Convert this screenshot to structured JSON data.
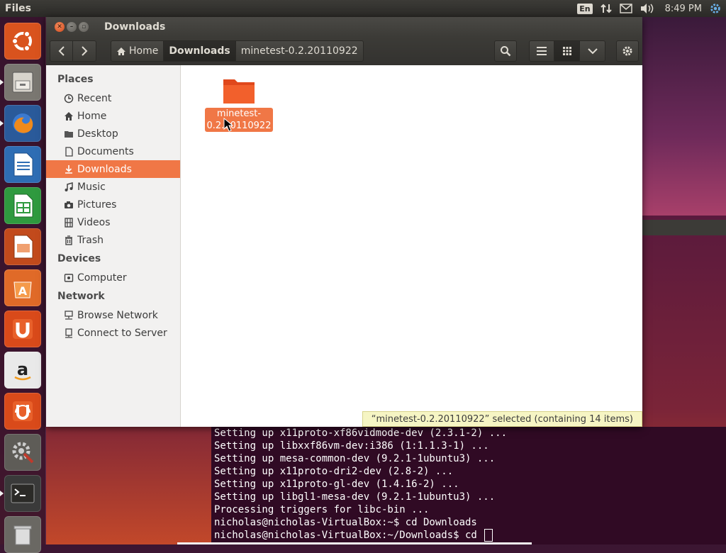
{
  "top_panel": {
    "app_title": "Files",
    "keyboard_layout": "En",
    "clock": "8:49 PM",
    "indicators": [
      "network-icon",
      "mail-icon",
      "volume-icon",
      "settings-gear-icon"
    ]
  },
  "launcher": {
    "items": [
      {
        "name": "dash-home",
        "icon": "ubuntu-logo-icon"
      },
      {
        "name": "files",
        "icon": "file-cabinet-icon",
        "running": true
      },
      {
        "name": "firefox",
        "icon": "firefox-icon",
        "running": true
      },
      {
        "name": "libreoffice-writer",
        "icon": "writer-icon"
      },
      {
        "name": "libreoffice-calc",
        "icon": "calc-icon"
      },
      {
        "name": "libreoffice-impress",
        "icon": "impress-icon"
      },
      {
        "name": "ubuntu-software-center",
        "icon": "software-center-icon"
      },
      {
        "name": "ubuntu-one",
        "icon": "ubuntu-one-icon"
      },
      {
        "name": "amazon",
        "icon": "amazon-icon"
      },
      {
        "name": "ubuntu-one-music",
        "icon": "ubuntu-one-music-icon"
      },
      {
        "name": "system-settings",
        "icon": "system-settings-icon"
      },
      {
        "name": "terminal",
        "icon": "terminal-icon",
        "running": true
      },
      {
        "name": "trash",
        "icon": "trash-icon"
      }
    ]
  },
  "window": {
    "title": "Downloads",
    "breadcrumbs": [
      "Home",
      "Downloads",
      "minetest-0.2.20110922"
    ],
    "active_crumb": "Downloads"
  },
  "sidebar": {
    "sections": [
      {
        "title": "Places",
        "items": [
          {
            "label": "Recent",
            "icon": "clock-icon"
          },
          {
            "label": "Home",
            "icon": "home-icon"
          },
          {
            "label": "Desktop",
            "icon": "desktop-folder-icon"
          },
          {
            "label": "Documents",
            "icon": "document-icon"
          },
          {
            "label": "Downloads",
            "icon": "download-arrow-icon",
            "selected": true
          },
          {
            "label": "Music",
            "icon": "music-note-icon"
          },
          {
            "label": "Pictures",
            "icon": "camera-icon"
          },
          {
            "label": "Videos",
            "icon": "film-icon"
          },
          {
            "label": "Trash",
            "icon": "trash-icon"
          }
        ]
      },
      {
        "title": "Devices",
        "items": [
          {
            "label": "Computer",
            "icon": "harddisk-icon"
          }
        ]
      },
      {
        "title": "Network",
        "items": [
          {
            "label": "Browse Network",
            "icon": "network-icon"
          },
          {
            "label": "Connect to Server",
            "icon": "server-icon"
          }
        ]
      }
    ]
  },
  "files": [
    {
      "name": "minetest-0.2.20110922",
      "type": "folder",
      "selected": true,
      "label_line1": "minetest-",
      "label_line2": "0.2.20110922"
    }
  ],
  "statusbar": {
    "text": "“minetest-0.2.20110922” selected  (containing 14 items)"
  },
  "terminal": {
    "lines": [
      "Setting up x11proto-xf86vidmode-dev (2.3.1-2) ...",
      "Setting up libxxf86vm-dev:i386 (1:1.1.3-1) ...",
      "Setting up mesa-common-dev (9.2.1-1ubuntu3) ...",
      "Setting up x11proto-dri2-dev (2.8-2) ...",
      "Setting up x11proto-gl-dev (1.4.16-2) ...",
      "Setting up libgl1-mesa-dev (9.2.1-1ubuntu3) ...",
      "Processing triggers for libc-bin ...",
      "nicholas@nicholas-VirtualBox:~$ cd Downloads",
      "nicholas@nicholas-VirtualBox:~/Downloads$ cd "
    ]
  },
  "colors": {
    "accent_orange": "#f07746",
    "panel_dark": "#3c3b37",
    "terminal_bg": "#300a24",
    "status_bg": "#f6f5c4"
  }
}
